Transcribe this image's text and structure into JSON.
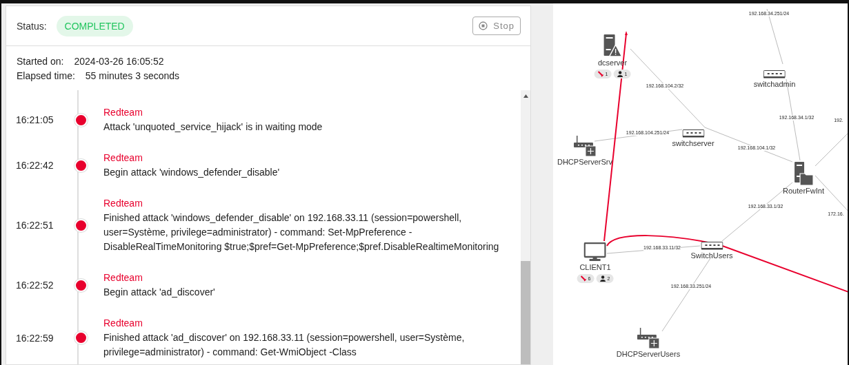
{
  "status": {
    "label": "Status:",
    "value": "COMPLETED"
  },
  "stop_button": {
    "label": "Stop",
    "disabled": true
  },
  "info": [
    {
      "label": "Started on:",
      "value": "2024-03-26 16:05:52"
    },
    {
      "label": "Elapsed time:",
      "value": "55 minutes 3 seconds"
    }
  ],
  "events": [
    {
      "time": "16:21:05",
      "source": "Redteam",
      "message": "Attack 'unquoted_service_hijack' is in waiting mode"
    },
    {
      "time": "16:22:42",
      "source": "Redteam",
      "message": "Begin attack 'windows_defender_disable'"
    },
    {
      "time": "16:22:51",
      "source": "Redteam",
      "message": "Finished attack 'windows_defender_disable' on 192.168.33.11 (session=powershell, user=Système, privilege=administrator) - command: Set-MpPreference -DisableRealTimeMonitoring $true;$pref=Get-MpPreference;$pref.DisableRealtimeMonitoring"
    },
    {
      "time": "16:22:52",
      "source": "Redteam",
      "message": "Begin attack 'ad_discover'"
    },
    {
      "time": "16:22:59",
      "source": "Redteam",
      "message": "Finished attack 'ad_discover' on 192.168.33.11 (session=powershell, user=Système, privilege=administrator) - command: Get-WmiObject -Class"
    }
  ],
  "network": {
    "nodes": [
      {
        "name": "dcserver",
        "kind": "server-alert",
        "badges": [
          {
            "kind": "attack",
            "count": "1"
          },
          {
            "kind": "user",
            "count": "1"
          }
        ]
      },
      {
        "name": "switchadmin",
        "kind": "switch"
      },
      {
        "name": "DHCPServerSrv",
        "kind": "router"
      },
      {
        "name": "switchserver",
        "kind": "switch"
      },
      {
        "name": "RouterFwInt",
        "kind": "firewall"
      },
      {
        "name": "CLIENT1",
        "kind": "computer",
        "badges": [
          {
            "kind": "attack",
            "count": "6"
          },
          {
            "kind": "user",
            "count": "2"
          }
        ]
      },
      {
        "name": "SwitchUsers",
        "kind": "switch"
      },
      {
        "name": "DHCPServerUsers",
        "kind": "router"
      }
    ],
    "links": [
      "192.168.34.251/24",
      "192.168.104.2/32",
      "192.168.34.1/32",
      "192.",
      "192.168.104.251/24",
      "192.168.104.1/32",
      "192.168.33.1/32",
      "172.16.",
      "192.168.33.11/32",
      "192.168.33.251/24"
    ]
  }
}
